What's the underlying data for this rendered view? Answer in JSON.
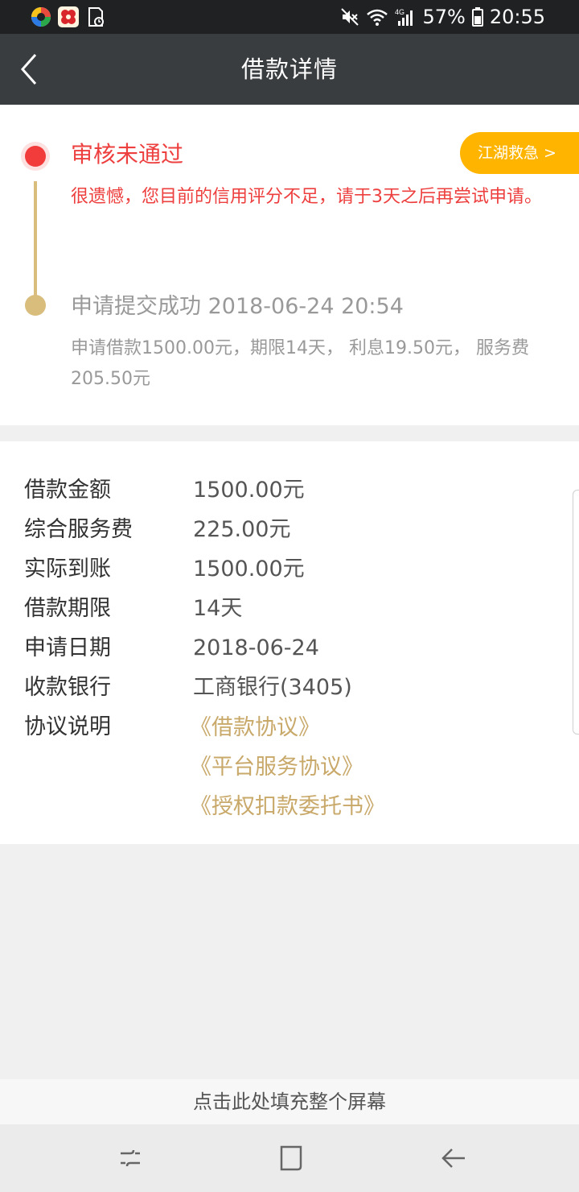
{
  "status_bar": {
    "battery": "57%",
    "time": "20:55",
    "network": "4G",
    "icons": [
      "app-icon-colorful",
      "app-icon-red",
      "notification-file-icon",
      "mute-icon",
      "wifi-icon",
      "signal-icon",
      "battery-icon"
    ]
  },
  "header": {
    "title": "借款详情",
    "back_icon": "chevron-left-icon"
  },
  "timeline": {
    "rejected": {
      "title": "审核未通过",
      "message": "很遗憾，您目前的信用评分不足，请于3天之后再尝试申请。",
      "color": "#ee3f3f"
    },
    "submitted": {
      "title": "申请提交成功 2018-06-24 20:54",
      "detail": "申请借款1500.00元，期限14天， 利息19.50元， 服务费205.50元"
    },
    "promo_button": "江湖救急 >"
  },
  "details": {
    "rows": [
      {
        "label": "借款金额",
        "value": "1500.00元"
      },
      {
        "label": "综合服务费",
        "value": "225.00元"
      },
      {
        "label": "实际到账",
        "value": "1500.00元"
      },
      {
        "label": "借款期限",
        "value": "14天"
      },
      {
        "label": "申请日期",
        "value": "2018-06-24"
      },
      {
        "label": "收款银行",
        "value": "工商银行(3405)"
      }
    ],
    "agreement_label": "协议说明",
    "agreements": [
      "《借款协议》",
      "《平台服务协议》",
      "《授权扣款委托书》"
    ]
  },
  "fill_screen": "点击此处填充整个屏幕",
  "colors": {
    "accent_gold": "#c9a96a",
    "promo_orange": "#ffb400",
    "header_bg": "#3a3d40"
  }
}
